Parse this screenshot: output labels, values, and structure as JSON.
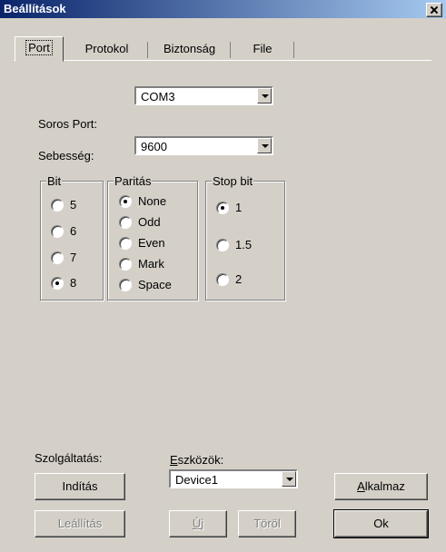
{
  "window": {
    "title": "Beállítások"
  },
  "tabs": [
    {
      "label": "Port",
      "active": true
    },
    {
      "label": "Protokol",
      "active": false
    },
    {
      "label": "Biztonság",
      "active": false
    },
    {
      "label": "File",
      "active": false
    }
  ],
  "port": {
    "serial_label": "Soros Port:",
    "serial_value": "COM3",
    "speed_label": "Sebesség:",
    "speed_value": "9600"
  },
  "bit_group": {
    "title": "Bit",
    "options": [
      {
        "label": "5",
        "checked": false
      },
      {
        "label": "6",
        "checked": false
      },
      {
        "label": "7",
        "checked": false
      },
      {
        "label": "8",
        "checked": true
      }
    ]
  },
  "parity_group": {
    "title": "Paritás",
    "options": [
      {
        "label": "None",
        "checked": true
      },
      {
        "label": "Odd",
        "checked": false
      },
      {
        "label": "Even",
        "checked": false
      },
      {
        "label": "Mark",
        "checked": false
      },
      {
        "label": "Space",
        "checked": false
      }
    ]
  },
  "stopbit_group": {
    "title": "Stop bit",
    "options": [
      {
        "label": "1",
        "checked": true
      },
      {
        "label": "1.5",
        "checked": false
      },
      {
        "label": "2",
        "checked": false
      }
    ]
  },
  "service": {
    "label": "Szolgáltatás:",
    "start_button": "Indítás",
    "stop_button": "Leállítás"
  },
  "tools": {
    "label_prefix": "E",
    "label_rest": "szközök:",
    "device_value": "Device1",
    "new_button_prefix": "Ú",
    "new_button_rest": "j",
    "delete_button": "Töröl"
  },
  "actions": {
    "apply_prefix": "A",
    "apply_rest": "lkalmaz",
    "ok_button": "Ok"
  }
}
